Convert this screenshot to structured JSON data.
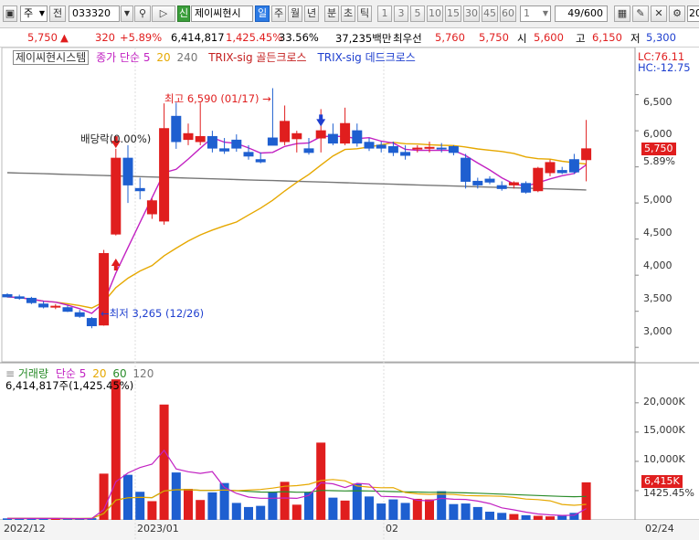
{
  "toolbar": {
    "period_type": "주",
    "prev_label": "전",
    "code": "033320",
    "new_badge": "신",
    "stock_name": "제이씨현시",
    "period_buttons": [
      "일",
      "주",
      "월",
      "년",
      "분",
      "초",
      "틱"
    ],
    "selected_period": "일",
    "interval_buttons": [
      "1",
      "3",
      "5",
      "10",
      "15",
      "30",
      "45",
      "60"
    ],
    "count_select": "1",
    "page_counter": "49/600",
    "right_value": "20"
  },
  "quote": {
    "price": "5,750",
    "arrow": "▲",
    "change": "320",
    "change_pct": "+5.89%",
    "volume": "6,414,817",
    "volume_ratio": "1,425.45%",
    "turnover": "33.56%",
    "amount": "37,235백만",
    "best_ask_label": "최우선",
    "best_ask": "5,760",
    "best_bid": "5,750",
    "open_label": "시",
    "open": "5,600",
    "high_label": "고",
    "high": "6,150",
    "low_label": "저",
    "low": "5,300"
  },
  "price_panel": {
    "legend_system": "제이씨현시스템",
    "legend_ma": "종가 단순 5",
    "legend_ma20": "20",
    "legend_ma240": "240",
    "legend_golden": "TRIX-sig 골든크로스",
    "legend_dead": "TRIX-sig 데드크로스",
    "lc": "LC:76.11",
    "hc": "HC:-12.75",
    "ann_high": "최고 6,590 (01/17)",
    "ann_low": "최저 3,265 (12/26)",
    "ann_dividend": "배당락(0.00%)",
    "current_tag": "5,750",
    "current_pct": "5.89%",
    "y_ticks": [
      "6,500",
      "6,000",
      "5,500",
      "5,000",
      "4,500",
      "4,000",
      "3,500",
      "3,000"
    ]
  },
  "volume_panel": {
    "legend_vol": "거래량",
    "legend_ma": "단순 5",
    "legend_20": "20",
    "legend_60": "60",
    "legend_120": "120",
    "info": "6,414,817주(1,425.45%)",
    "current_tag": "6,415K",
    "current_pct": "1425.45%",
    "y_ticks": [
      "20,000K",
      "15,000K",
      "10,000K",
      "5,000K"
    ]
  },
  "x_axis": {
    "labels": [
      "2022/12",
      "2023/01",
      "02",
      "02/24"
    ]
  },
  "chart_data": {
    "type": "candlestick",
    "candles": [
      {
        "o": 3730,
        "h": 3750,
        "l": 3690,
        "c": 3700
      },
      {
        "o": 3700,
        "h": 3730,
        "l": 3660,
        "c": 3680
      },
      {
        "o": 3680,
        "h": 3700,
        "l": 3600,
        "c": 3620
      },
      {
        "o": 3600,
        "h": 3640,
        "l": 3540,
        "c": 3560
      },
      {
        "o": 3560,
        "h": 3600,
        "l": 3530,
        "c": 3570
      },
      {
        "o": 3550,
        "h": 3580,
        "l": 3490,
        "c": 3500
      },
      {
        "o": 3480,
        "h": 3520,
        "l": 3410,
        "c": 3430
      },
      {
        "o": 3400,
        "h": 3420,
        "l": 3265,
        "c": 3300
      },
      {
        "o": 3310,
        "h": 4350,
        "l": 3300,
        "c": 4300
      },
      {
        "o": 4570,
        "h": 5750,
        "l": 4550,
        "c": 5620
      },
      {
        "o": 5620,
        "h": 5800,
        "l": 5000,
        "c": 5250
      },
      {
        "o": 5200,
        "h": 5350,
        "l": 5050,
        "c": 5170
      },
      {
        "o": 4850,
        "h": 5060,
        "l": 4780,
        "c": 5030
      },
      {
        "o": 4750,
        "h": 6380,
        "l": 4700,
        "c": 6030
      },
      {
        "o": 6200,
        "h": 6390,
        "l": 5750,
        "c": 5850
      },
      {
        "o": 5880,
        "h": 6100,
        "l": 5800,
        "c": 5960
      },
      {
        "o": 5850,
        "h": 6390,
        "l": 5800,
        "c": 5920
      },
      {
        "o": 5920,
        "h": 6000,
        "l": 5700,
        "c": 5760
      },
      {
        "o": 5750,
        "h": 5900,
        "l": 5680,
        "c": 5720
      },
      {
        "o": 5870,
        "h": 5950,
        "l": 5710,
        "c": 5760
      },
      {
        "o": 5700,
        "h": 5800,
        "l": 5600,
        "c": 5650
      },
      {
        "o": 5600,
        "h": 5700,
        "l": 5550,
        "c": 5570
      },
      {
        "o": 5900,
        "h": 6590,
        "l": 5800,
        "c": 5800
      },
      {
        "o": 5850,
        "h": 6350,
        "l": 5800,
        "c": 6130
      },
      {
        "o": 5890,
        "h": 6000,
        "l": 5700,
        "c": 5960
      },
      {
        "o": 5750,
        "h": 5900,
        "l": 5670,
        "c": 5700
      },
      {
        "o": 5900,
        "h": 6300,
        "l": 5700,
        "c": 6000
      },
      {
        "o": 5950,
        "h": 6100,
        "l": 5800,
        "c": 5830
      },
      {
        "o": 5830,
        "h": 6320,
        "l": 5800,
        "c": 6100
      },
      {
        "o": 6000,
        "h": 6100,
        "l": 5780,
        "c": 5830
      },
      {
        "o": 5840,
        "h": 5900,
        "l": 5720,
        "c": 5760
      },
      {
        "o": 5800,
        "h": 5850,
        "l": 5700,
        "c": 5760
      },
      {
        "o": 5780,
        "h": 5850,
        "l": 5650,
        "c": 5700
      },
      {
        "o": 5700,
        "h": 5800,
        "l": 5600,
        "c": 5660
      },
      {
        "o": 5750,
        "h": 5800,
        "l": 5700,
        "c": 5760
      },
      {
        "o": 5760,
        "h": 5850,
        "l": 5700,
        "c": 5770
      },
      {
        "o": 5760,
        "h": 5830,
        "l": 5700,
        "c": 5750
      },
      {
        "o": 5780,
        "h": 5800,
        "l": 5660,
        "c": 5700
      },
      {
        "o": 5620,
        "h": 5680,
        "l": 5200,
        "c": 5300
      },
      {
        "o": 5300,
        "h": 5350,
        "l": 5200,
        "c": 5250
      },
      {
        "o": 5330,
        "h": 5370,
        "l": 5260,
        "c": 5290
      },
      {
        "o": 5240,
        "h": 5300,
        "l": 5170,
        "c": 5200
      },
      {
        "o": 5250,
        "h": 5300,
        "l": 5200,
        "c": 5280
      },
      {
        "o": 5270,
        "h": 5300,
        "l": 5130,
        "c": 5150
      },
      {
        "o": 5170,
        "h": 5500,
        "l": 5150,
        "c": 5480
      },
      {
        "o": 5420,
        "h": 5600,
        "l": 5370,
        "c": 5560
      },
      {
        "o": 5450,
        "h": 5500,
        "l": 5400,
        "c": 5420
      },
      {
        "o": 5600,
        "h": 5680,
        "l": 5400,
        "c": 5430
      },
      {
        "o": 5600,
        "h": 6150,
        "l": 5300,
        "c": 5750
      }
    ],
    "candle_colors": {
      "up": "#e01e1e",
      "down": "#1e5fd0"
    },
    "volume": [
      260,
      260,
      240,
      230,
      230,
      220,
      200,
      300,
      7900,
      24000,
      7700,
      4800,
      3200,
      19700,
      8100,
      5300,
      3400,
      4700,
      6300,
      2900,
      2200,
      2400,
      4700,
      6500,
      2600,
      4700,
      13200,
      3800,
      3300,
      6200,
      4000,
      2800,
      3500,
      2900,
      3600,
      3500,
      4900,
      2700,
      2800,
      2200,
      1400,
      1200,
      1000,
      800,
      700,
      600,
      700,
      1200,
      6415
    ],
    "volume_unit": "K",
    "ylim_price": [
      2800,
      6900
    ],
    "ylim_volume": [
      0,
      24500
    ]
  }
}
